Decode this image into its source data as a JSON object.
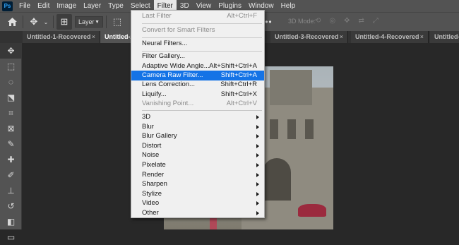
{
  "menubar": {
    "logo": "Ps",
    "items": [
      "File",
      "Edit",
      "Image",
      "Layer",
      "Type",
      "Select",
      "Filter",
      "3D",
      "View",
      "Plugins",
      "Window",
      "Help"
    ],
    "active": "Filter"
  },
  "options": {
    "layer_select": "Layer",
    "mode_label": "3D Mode:"
  },
  "tabs": [
    {
      "label": "Untitled-1-Recovered",
      "close": "×"
    },
    {
      "label": "Untitled-2-",
      "close": ""
    },
    {
      "label": "Untitled-3-Recovered",
      "close": "×"
    },
    {
      "label": "Untitled-4-Recovered",
      "close": "×"
    },
    {
      "label": "Untitled-1",
      "close": ""
    }
  ],
  "filter_menu": {
    "items": [
      {
        "label": "Last Filter",
        "shortcut": "Alt+Ctrl+F",
        "disabled": true
      },
      {
        "label": "Convert for Smart Filters",
        "shortcut": "",
        "disabled": true
      },
      {
        "label": "Neural Filters...",
        "shortcut": "",
        "disabled": false
      },
      {
        "label": "Filter Gallery...",
        "shortcut": "",
        "disabled": false
      },
      {
        "label": "Adaptive Wide Angle...",
        "shortcut": "Alt+Shift+Ctrl+A",
        "disabled": false
      },
      {
        "label": "Camera Raw Filter...",
        "shortcut": "Shift+Ctrl+A",
        "disabled": false,
        "highlighted": true
      },
      {
        "label": "Lens Correction...",
        "shortcut": "Shift+Ctrl+R",
        "disabled": false
      },
      {
        "label": "Liquify...",
        "shortcut": "Shift+Ctrl+X",
        "disabled": false
      },
      {
        "label": "Vanishing Point...",
        "shortcut": "Alt+Ctrl+V",
        "disabled": true
      },
      {
        "label": "3D",
        "submenu": true
      },
      {
        "label": "Blur",
        "submenu": true
      },
      {
        "label": "Blur Gallery",
        "submenu": true
      },
      {
        "label": "Distort",
        "submenu": true
      },
      {
        "label": "Noise",
        "submenu": true
      },
      {
        "label": "Pixelate",
        "submenu": true
      },
      {
        "label": "Render",
        "submenu": true
      },
      {
        "label": "Sharpen",
        "submenu": true
      },
      {
        "label": "Stylize",
        "submenu": true
      },
      {
        "label": "Video",
        "submenu": true
      },
      {
        "label": "Other",
        "submenu": true
      }
    ]
  },
  "toolbar_tools": [
    "move-tool",
    "marquee-tool",
    "lasso-tool",
    "object-select-tool",
    "crop-tool",
    "frame-tool",
    "eyedropper-tool",
    "healing-brush-tool",
    "brush-tool",
    "clone-stamp-tool",
    "history-brush-tool",
    "eraser-tool",
    "gradient-tool"
  ]
}
